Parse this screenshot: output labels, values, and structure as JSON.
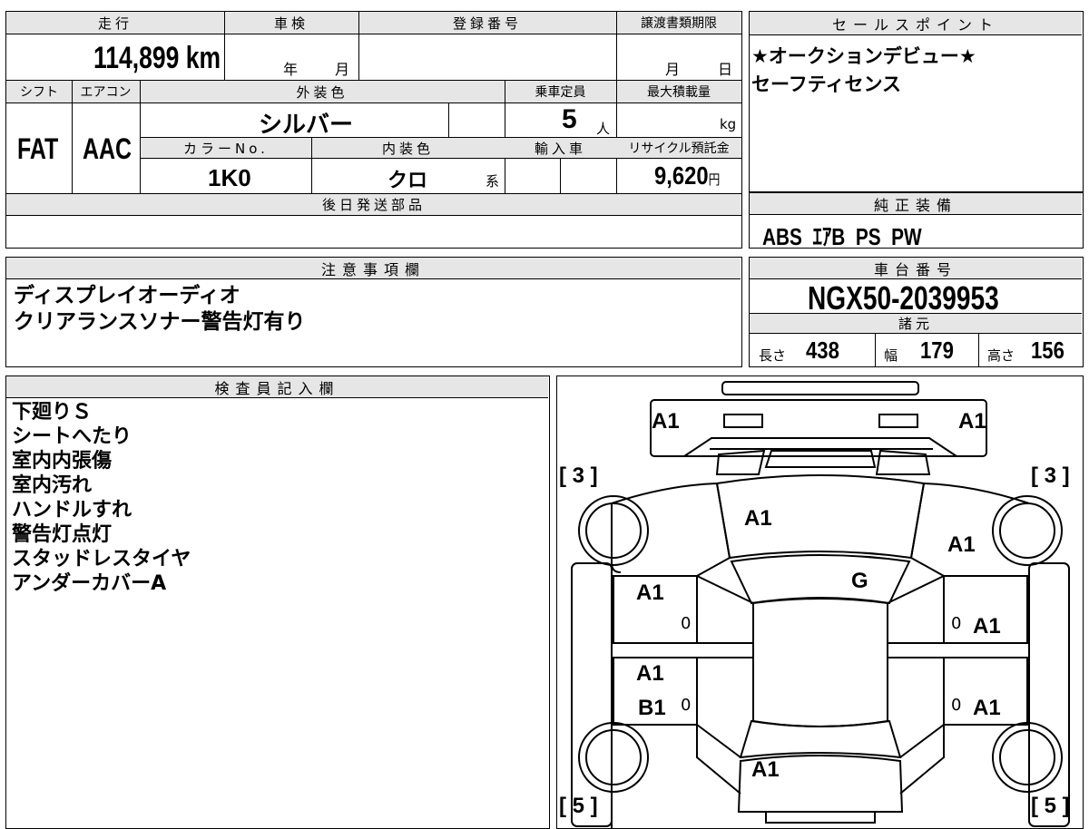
{
  "headers": {
    "mileage": "走行",
    "inspection": "車検",
    "registration": "登録番号",
    "transfer_deadline": "譲渡書類期限",
    "shift": "シフト",
    "aircon": "エアコン",
    "exterior_color": "外装色",
    "capacity": "乗車定員",
    "max_load": "最大積載量",
    "color_no": "カラーNo.",
    "interior_color": "内装色",
    "import": "輸入車",
    "recycle": "リサイクル預託金",
    "later_parts": "後日発送部品",
    "sales_point": "セールスポイント",
    "equipment": "純正装備",
    "notes": "注意事項欄",
    "chassis": "車台番号",
    "specs": "諸元",
    "inspector": "検査員記入欄"
  },
  "values": {
    "mileage": "114,899",
    "mileage_unit": "km",
    "year_label": "年",
    "month_label": "月",
    "deadline_month": "月",
    "deadline_day": "日",
    "shift": "FAT",
    "aircon": "AAC",
    "exterior_color": "シルバー",
    "capacity": "5",
    "capacity_unit": "人",
    "max_load_unit": "kg",
    "color_no": "1K0",
    "interior_color": "クロ",
    "interior_suffix": "系",
    "recycle": "9,620",
    "recycle_unit": "円"
  },
  "sales_points": [
    "★オークションデビュー★",
    "セーフティセンス"
  ],
  "equipment": "ABS  ｴｱB  PS  PW",
  "notes": [
    "ディスプレイオーディオ",
    "クリアランスソナー警告灯有り"
  ],
  "chassis_number": "NGX50-2039953",
  "specs": {
    "length_label": "長さ",
    "length": "438",
    "width_label": "幅",
    "width": "179",
    "height_label": "高さ",
    "height": "156"
  },
  "inspector_notes": [
    "下廻りＳ",
    "シートへたり",
    "室内内張傷",
    "室内汚れ",
    "ハンドルすれ",
    "警告灯点灯",
    "スタッドレスタイヤ",
    "アンダーカバーA"
  ],
  "diagram": {
    "labels": {
      "front_left": "A1",
      "front_right": "A1",
      "hood": "A1",
      "right_fender": "A1",
      "windshield": "G",
      "left_front_door": "A1",
      "right_front_door": "A1",
      "left_rear_door": "A1",
      "left_rear_door_2": "B1",
      "right_rear_door": "A1",
      "rear": "A1"
    },
    "tire_tl": "[ 3 ]",
    "tire_tr": "[ 3 ]",
    "tire_bl": "[ 5 ]",
    "tire_br": "[ 5 ]",
    "zero_marks": [
      "0",
      "0",
      "0",
      "0"
    ]
  }
}
